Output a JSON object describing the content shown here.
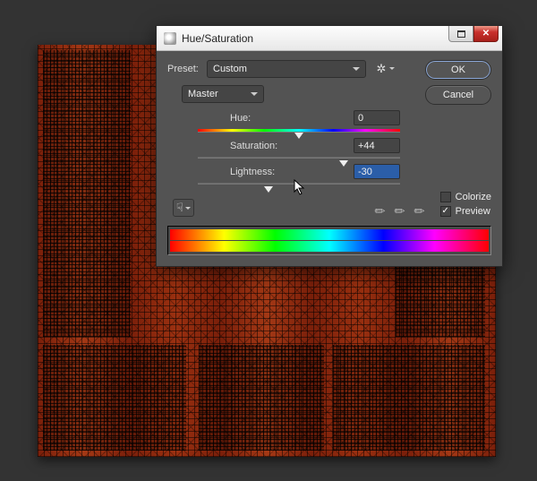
{
  "dialog": {
    "title": "Hue/Saturation",
    "preset_label": "Preset:",
    "preset_value": "Custom",
    "channel_value": "Master",
    "ok_label": "OK",
    "cancel_label": "Cancel",
    "sliders": {
      "hue": {
        "label": "Hue:",
        "value": "0",
        "position_pct": 50
      },
      "saturation": {
        "label": "Saturation:",
        "value": "+44",
        "position_pct": 72
      },
      "lightness": {
        "label": "Lightness:",
        "value": "-30",
        "position_pct": 35
      }
    },
    "colorize": {
      "label": "Colorize",
      "checked": false
    },
    "preview": {
      "label": "Preview",
      "checked": true
    }
  }
}
